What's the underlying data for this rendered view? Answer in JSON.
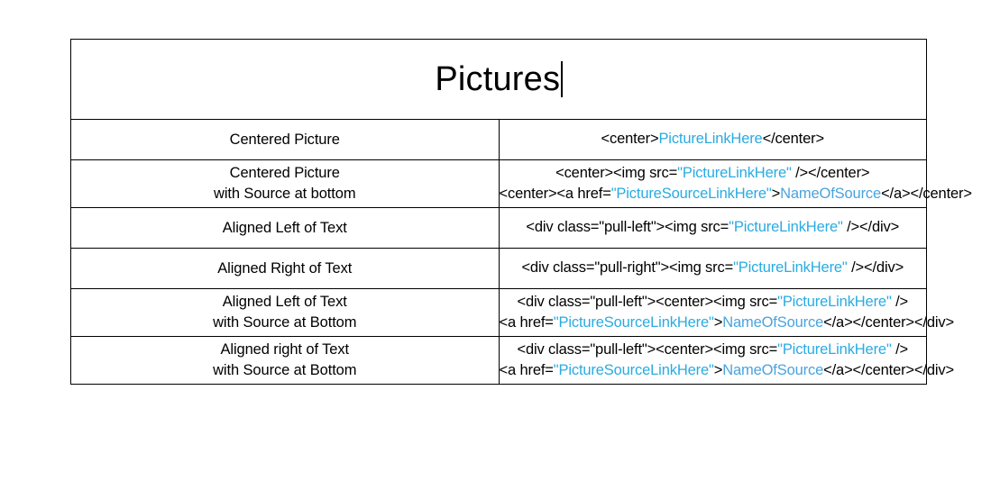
{
  "document": {
    "title": "Pictures",
    "caret_visible": true,
    "colors": {
      "link_token": "#29abe2",
      "name_token": "#4aa3dd",
      "text": "#000000",
      "border": "#000000",
      "background": "#ffffff"
    }
  },
  "table": {
    "rows": [
      {
        "label": "Centered Picture",
        "lines": [
          [
            {
              "text": "<center>",
              "style": "plain"
            },
            {
              "text": "PictureLinkHere",
              "style": "link"
            },
            {
              "text": "</center>",
              "style": "plain"
            }
          ]
        ]
      },
      {
        "label": "Centered Picture\nwith Source at bottom",
        "lines": [
          [
            {
              "text": "<center><img src=",
              "style": "plain"
            },
            {
              "text": "\"PictureLinkHere\"",
              "style": "link"
            },
            {
              "text": " /></center>",
              "style": "plain"
            }
          ],
          [
            {
              "text": "<center><a href=",
              "style": "plain"
            },
            {
              "text": "\"PictureSourceLinkHere\"",
              "style": "link"
            },
            {
              "text": ">",
              "style": "plain"
            },
            {
              "text": "NameOfSource",
              "style": "name"
            },
            {
              "text": "</a></center>",
              "style": "plain"
            }
          ]
        ]
      },
      {
        "label": "Aligned Left of Text",
        "lines": [
          [
            {
              "text": "<div class=\"pull-left\"><img src=",
              "style": "plain"
            },
            {
              "text": "\"PictureLinkHere\"",
              "style": "link"
            },
            {
              "text": " /></div>",
              "style": "plain"
            }
          ]
        ]
      },
      {
        "label": "Aligned Right of Text",
        "lines": [
          [
            {
              "text": "<div class=\"pull-right\"><img src=",
              "style": "plain"
            },
            {
              "text": "\"PictureLinkHere\"",
              "style": "link"
            },
            {
              "text": " /></div>",
              "style": "plain"
            }
          ]
        ]
      },
      {
        "label": "Aligned Left of Text\nwith Source at Bottom",
        "lines": [
          [
            {
              "text": "<div class=\"pull-left\"><center><img src=",
              "style": "plain"
            },
            {
              "text": "\"PictureLinkHere\"",
              "style": "link"
            },
            {
              "text": " />",
              "style": "plain"
            }
          ],
          [
            {
              "text": "<a href=",
              "style": "plain"
            },
            {
              "text": "\"PictureSourceLinkHere\"",
              "style": "link"
            },
            {
              "text": ">",
              "style": "plain"
            },
            {
              "text": "NameOfSource",
              "style": "name"
            },
            {
              "text": "</a></center></div>",
              "style": "plain"
            }
          ]
        ]
      },
      {
        "label": "Aligned right of Text\nwith Source at Bottom",
        "lines": [
          [
            {
              "text": "<div class=\"pull-left\"><center><img src=",
              "style": "plain"
            },
            {
              "text": "\"PictureLinkHere\"",
              "style": "link"
            },
            {
              "text": " />",
              "style": "plain"
            }
          ],
          [
            {
              "text": "<a href=",
              "style": "plain"
            },
            {
              "text": "\"PictureSourceLinkHere\"",
              "style": "link"
            },
            {
              "text": ">",
              "style": "plain"
            },
            {
              "text": "NameOfSource",
              "style": "name"
            },
            {
              "text": "</a></center></div>",
              "style": "plain"
            }
          ]
        ]
      }
    ]
  }
}
